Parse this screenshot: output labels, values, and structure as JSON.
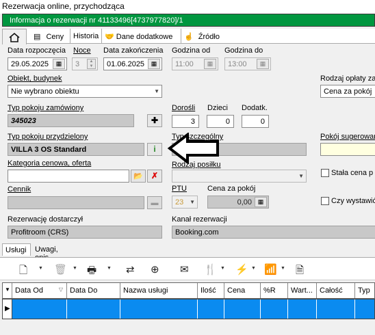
{
  "window": {
    "title": "Rezerwacja online, przychodząca"
  },
  "info_bar": {
    "text": "Informacja o rezerwacji nr 41133496[4737977820]/1"
  },
  "tabs": [
    {
      "label": ""
    },
    {
      "label": "Ceny"
    },
    {
      "label": "Historia"
    },
    {
      "label": "Dane dodatkowe"
    },
    {
      "label": "Źródło"
    }
  ],
  "form": {
    "start_date_label": "Data rozpoczęcia",
    "start_date": "29.05.2025",
    "nights_label": "Noce",
    "nights": "3",
    "end_date_label": "Data zakończenia",
    "end_date": "01.06.2025",
    "time_from_label": "Godzina od",
    "time_from": "11:00",
    "time_to_label": "Godzina do",
    "time_to": "13:00",
    "property_label": "Obiekt, budynek",
    "property_value": "Nie wybrano obiektu",
    "fee_type_label": "Rodzaj opłaty za",
    "fee_type_value": "Cena za pokój",
    "ordered_room_label": "Typ pokoju zamówiony",
    "ordered_room_value": "345023",
    "adults_label": "Dorośli",
    "adults": "3",
    "children_label": "Dzieci",
    "children": "0",
    "extra_label": "Dodatk.",
    "extra": "0",
    "assigned_room_label": "Typ pokoju przydzielony",
    "assigned_room_value": "VILLA 3 OS Standard",
    "special_type_label": "Typ szczególny",
    "suggested_room_label": "Pokój sugerowan",
    "price_category_label": "Kategoria cenowa, oferta",
    "price_category_value": "",
    "meal_type_label": "Rodzaj posiłku",
    "fixed_price_label": "Stała cena p",
    "pricelist_label": "Cennik",
    "ptu_label": "PTU",
    "ptu_value": "23",
    "room_price_label": "Cena za pokój",
    "room_price_value": "0,00",
    "issue_label": "Czy wystawić",
    "supplier_label": "Rezerwację dostarczył",
    "supplier_value": "Profitroom (CRS)",
    "channel_label": "Kanał rezerwacji",
    "channel_value": "Booking.com"
  },
  "subtabs": [
    {
      "label": "Usługi"
    },
    {
      "label": "Uwagi, opis"
    }
  ],
  "grid": {
    "columns": [
      "Data Od",
      "Data Do",
      "Nazwa usługi",
      "Ilość",
      "Cena",
      "%R",
      "Wart...",
      "Całość",
      "Typ"
    ]
  },
  "icons": {
    "home": "home-icon",
    "prices": "price-list-icon",
    "extra": "handshake-icon",
    "source": "hand-pointer-icon"
  }
}
